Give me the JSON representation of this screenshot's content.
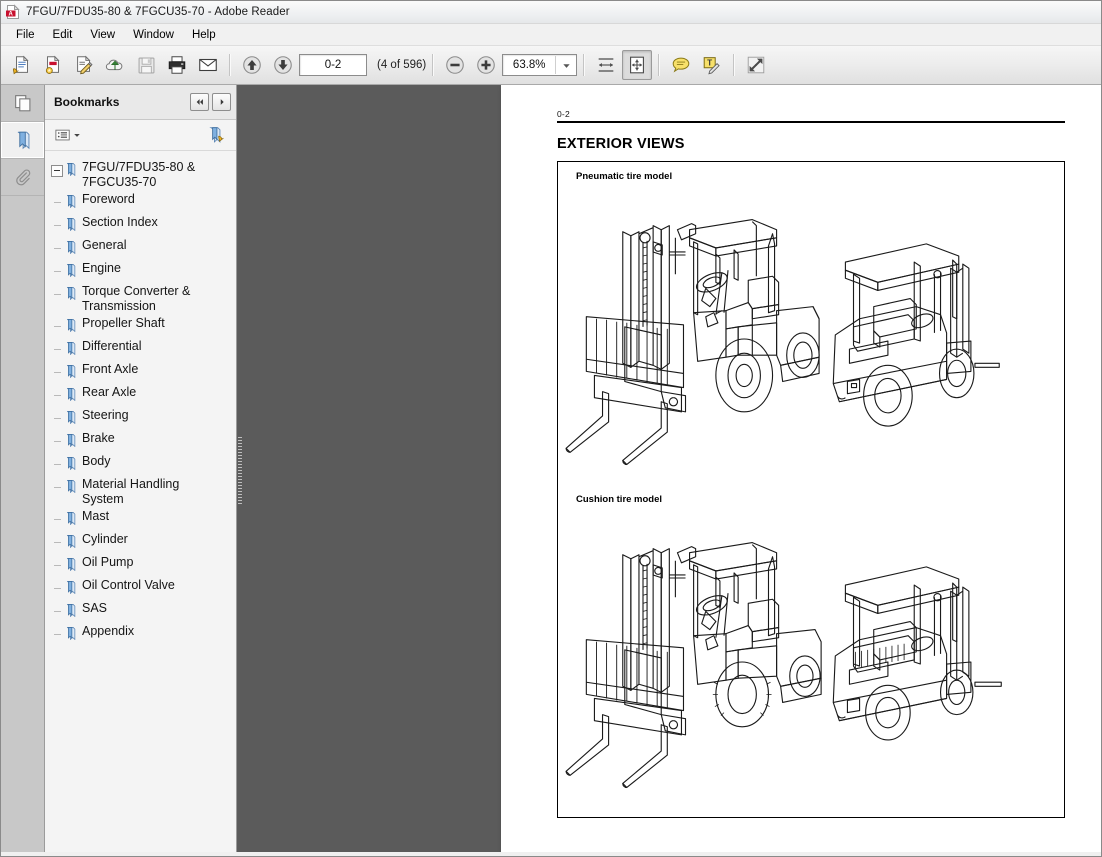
{
  "window": {
    "title": "7FGU/7FDU35-80 & 7FGCU35-70 - Adobe Reader",
    "app_icon": "adobe-pdf-icon"
  },
  "menubar": {
    "items": [
      {
        "label": "File"
      },
      {
        "label": "Edit"
      },
      {
        "label": "View"
      },
      {
        "label": "Window"
      },
      {
        "label": "Help"
      }
    ]
  },
  "toolbar": {
    "buttons": [
      {
        "name": "open-file-icon",
        "title": "Open"
      },
      {
        "name": "create-pdf-icon",
        "title": "Create PDF"
      },
      {
        "name": "sign-document-icon",
        "title": "Sign"
      },
      {
        "name": "upload-cloud-icon",
        "title": "Send files"
      },
      {
        "name": "save-icon",
        "title": "Save"
      },
      {
        "name": "print-icon",
        "title": "Print"
      },
      {
        "name": "email-icon",
        "title": "Email"
      }
    ],
    "previous_page_icon": "arrow-up-circle-icon",
    "next_page_icon": "arrow-down-circle-icon",
    "page_field_value": "0-2",
    "page_count_label": "(4 of 596)",
    "zoom_out_icon": "minus-circle-icon",
    "zoom_in_icon": "plus-circle-icon",
    "zoom_value": "63.8%",
    "zoom_dropdown_icon": "chevron-down-icon",
    "fit_width_icon": "fit-width-icon",
    "fit_page_icon": "fit-page-icon",
    "comment_icon": "comment-bubble-icon",
    "text_comment_icon": "text-edit-icon",
    "expand_icon": "expand-arrows-icon"
  },
  "rail": {
    "items": [
      {
        "name": "page-thumbnails-icon",
        "label": "Page Thumbnails",
        "active": false
      },
      {
        "name": "bookmarks-icon",
        "label": "Bookmarks",
        "active": true
      },
      {
        "name": "attachments-paperclip-icon",
        "label": "Attachments",
        "active": false
      }
    ]
  },
  "panel": {
    "title": "Bookmarks",
    "collapse_icon": "double-chevron-left-icon",
    "expand_icon": "chevron-right-icon",
    "options_icon": "options-list-icon",
    "options_arrow_icon": "chevron-down-icon",
    "new_bookmark_icon": "new-bookmark-icon",
    "root": {
      "label": "7FGU/7FDU35-80 & 7FGCU35-70",
      "expanded": true
    },
    "items": [
      {
        "label": "Foreword"
      },
      {
        "label": "Section Index"
      },
      {
        "label": "General"
      },
      {
        "label": "Engine"
      },
      {
        "label": "Torque Converter & Transmission"
      },
      {
        "label": "Propeller Shaft"
      },
      {
        "label": "Differential"
      },
      {
        "label": "Front Axle"
      },
      {
        "label": "Rear Axle"
      },
      {
        "label": "Steering"
      },
      {
        "label": "Brake"
      },
      {
        "label": "Body"
      },
      {
        "label": "Material Handling System"
      },
      {
        "label": "Mast"
      },
      {
        "label": "Cylinder"
      },
      {
        "label": "Oil Pump"
      },
      {
        "label": "Oil Control Valve"
      },
      {
        "label": "SAS"
      },
      {
        "label": "Appendix"
      }
    ]
  },
  "document": {
    "folio": "0-2",
    "heading": "EXTERIOR VIEWS",
    "figures": [
      {
        "label": "Pneumatic tire model",
        "name": "pneumatic-tire-model-figure"
      },
      {
        "label": "Cushion tire model",
        "name": "cushion-tire-model-figure"
      }
    ]
  },
  "colors": {
    "doc_background": "#5b5b5b",
    "panel_background": "#f4f4f4",
    "toolbar_background": "#ebebeb",
    "bookmark_icon": "#6f9fd8",
    "brand_red": "#c8102e"
  }
}
